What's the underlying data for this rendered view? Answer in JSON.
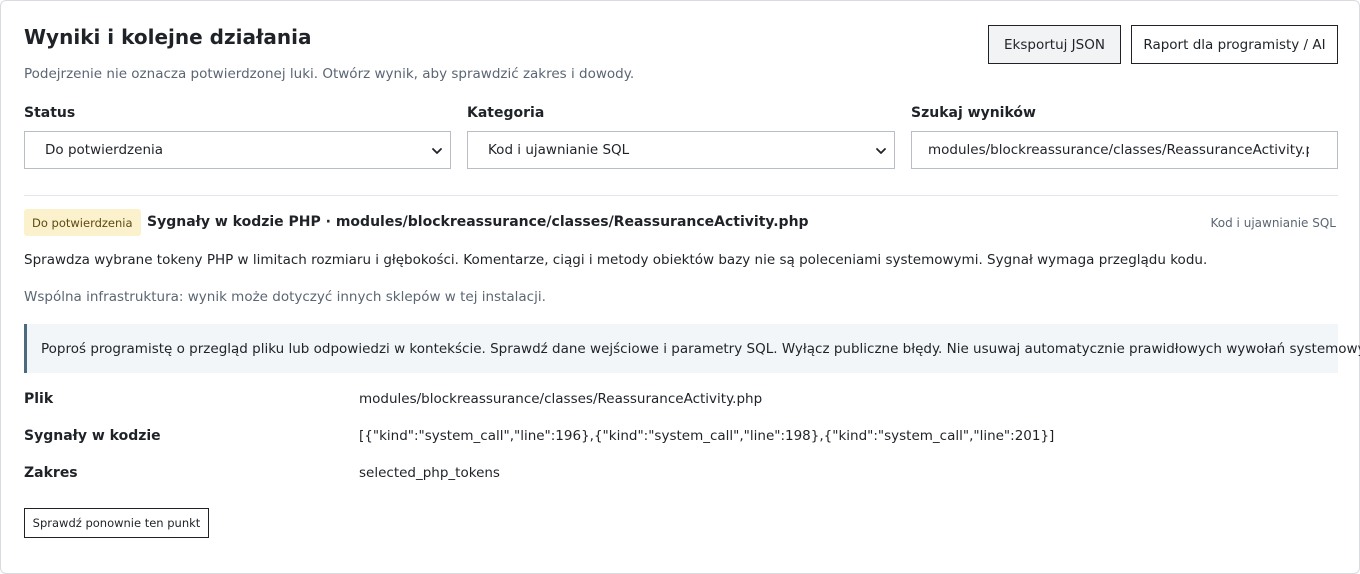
{
  "header": {
    "title": "Wyniki i kolejne działania",
    "subtitle": "Podejrzenie nie oznacza potwierdzonej luki. Otwórz wynik, aby sprawdzić zakres i dowody.",
    "export_label": "Eksportuj JSON",
    "report_label": "Raport dla programisty / AI"
  },
  "filters": {
    "status_label": "Status",
    "status_value": "Do potwierdzenia",
    "category_label": "Kategoria",
    "category_value": "Kod i ujawnianie SQL",
    "search_label": "Szukaj wyników",
    "search_value": "modules/blockreassurance/classes/ReassuranceActivity.php"
  },
  "finding": {
    "badge": "Do potwierdzenia",
    "title": "Sygnały w kodzie PHP · modules/blockreassurance/classes/ReassuranceActivity.php",
    "category": "Kod i ujawnianie SQL",
    "description": "Sprawdza wybrane tokeny PHP w limitach rozmiaru i głębokości. Komentarze, ciągi i metody obiektów bazy nie są poleceniami systemowymi. Sygnał wymaga przeglądu kodu.",
    "infra_note": "Wspólna infrastruktura: wynik może dotyczyć innych sklepów w tej instalacji.",
    "advice": "Poproś programistę o przegląd pliku lub odpowiedzi w kontekście. Sprawdź dane wejściowe i parametry SQL. Wyłącz publiczne błędy. Nie usuwaj automatycznie prawidłowych wywołań systemowych.",
    "details": [
      {
        "label": "Plik",
        "value": "modules/blockreassurance/classes/ReassuranceActivity.php"
      },
      {
        "label": "Sygnały w kodzie",
        "value": "[{\"kind\":\"system_call\",\"line\":196},{\"kind\":\"system_call\",\"line\":198},{\"kind\":\"system_call\",\"line\":201}]"
      },
      {
        "label": "Zakres",
        "value": "selected_php_tokens"
      }
    ],
    "recheck_label": "Sprawdź ponownie ten punkt"
  },
  "icons": {
    "select_chevron": "chevron-down-icon"
  },
  "colors": {
    "badge_bg": "#fbf1cd",
    "advice_bg": "#f3f6f8",
    "advice_border": "#4d6b7f",
    "muted_text": "#5b6673"
  }
}
